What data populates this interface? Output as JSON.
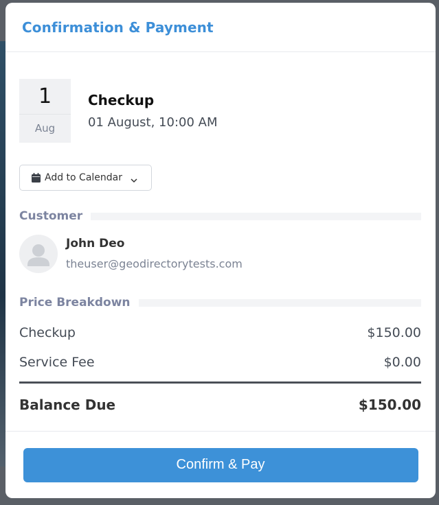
{
  "modal": {
    "title": "Confirmation & Payment"
  },
  "event": {
    "day": "1",
    "month": "Aug",
    "title": "Checkup",
    "datetime": "01 August, 10:00 AM"
  },
  "calendar": {
    "button_label": "Add to Calendar",
    "icon": "calendar-icon"
  },
  "customer": {
    "section_label": "Customer",
    "name": "John Deo",
    "email": "theuser@geodirectorytests.com",
    "avatar_icon": "user-placeholder-icon"
  },
  "price": {
    "section_label": "Price Breakdown",
    "items": [
      {
        "label": "Checkup",
        "amount": "$150.00"
      },
      {
        "label": "Service Fee",
        "amount": "$0.00"
      }
    ],
    "total_label": "Balance Due",
    "total_amount": "$150.00"
  },
  "footer": {
    "confirm_label": "Confirm & Pay"
  },
  "colors": {
    "accent": "#3d91d8",
    "title": "#3d8fd8",
    "section_label": "#7c84a0"
  }
}
